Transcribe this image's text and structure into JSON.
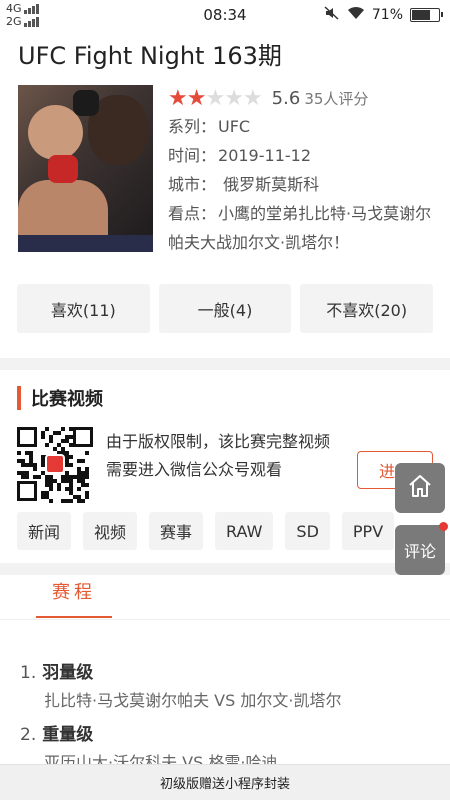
{
  "status_bar": {
    "network_top": "4G",
    "network_bottom": "2G",
    "time": "08:34",
    "battery": "71%",
    "battery_level": 0.71
  },
  "event": {
    "title": "UFC Fight Night 163期",
    "stars_filled": 2,
    "stars_total": 5,
    "score": "5.6",
    "votes": "35人评分",
    "series_label": "系列：",
    "series_value": "UFC",
    "date_label": "时间：",
    "date_value": "2019-11-12",
    "city_label": "城市：",
    "city_value": "俄罗斯莫斯科",
    "highlight_label": "看点：",
    "highlight_value": "小鹰的堂弟扎比特·马戈莫谢尔帕夫大战加尔文·凯塔尔！"
  },
  "votes": {
    "like": "喜欢(11)",
    "neutral": "一般(4)",
    "dislike": "不喜欢(20)"
  },
  "video_section": {
    "title": "比赛视频",
    "notice_line1": "由于版权限制，该比赛完整视频",
    "notice_line2": "需要进入微信公众号观看",
    "enter_button": "进入"
  },
  "tags": [
    "新闻",
    "视频",
    "赛事",
    "RAW",
    "SD",
    "PPV"
  ],
  "schedule": {
    "tab_label": "赛程",
    "bouts": [
      {
        "num": "1.",
        "weight_class": "羽量级",
        "fighters": "扎比特·马戈莫谢尔帕夫 VS 加尔文·凯塔尔"
      },
      {
        "num": "2.",
        "weight_class": "重量级",
        "fighters": "亚历山大·沃尔科夫 VS 格雷·哈迪"
      }
    ]
  },
  "float_buttons": {
    "home_icon": "home-icon",
    "comment_label": "评论"
  },
  "footer": {
    "text": "初级版赠送小程序封装"
  },
  "colors": {
    "accent": "#e35a35",
    "star_on": "#e64a3b",
    "star_off": "#dddddd"
  }
}
